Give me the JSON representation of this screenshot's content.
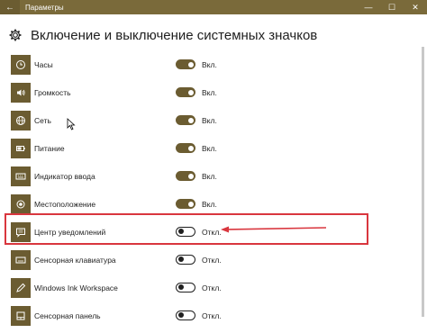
{
  "window": {
    "title": "Параметры",
    "back_glyph": "←",
    "minimize_glyph": "—",
    "maximize_glyph": "☐",
    "close_glyph": "✕"
  },
  "header": {
    "title": "Включение и выключение системных значков",
    "icon": "gear-icon"
  },
  "items": [
    {
      "label": "Часы",
      "state": "Вкл.",
      "on": true,
      "icon": "clock-icon"
    },
    {
      "label": "Громкость",
      "state": "Вкл.",
      "on": true,
      "icon": "volume-icon"
    },
    {
      "label": "Сеть",
      "state": "Вкл.",
      "on": true,
      "icon": "network-icon"
    },
    {
      "label": "Питание",
      "state": "Вкл.",
      "on": true,
      "icon": "power-icon"
    },
    {
      "label": "Индикатор ввода",
      "state": "Вкл.",
      "on": true,
      "icon": "keyboard-icon"
    },
    {
      "label": "Местоположение",
      "state": "Вкл.",
      "on": true,
      "icon": "location-icon"
    },
    {
      "label": "Центр уведомлений",
      "state": "Откл.",
      "on": false,
      "icon": "action-center-icon"
    },
    {
      "label": "Сенсорная клавиатура",
      "state": "Откл.",
      "on": false,
      "icon": "touch-keyboard-icon"
    },
    {
      "label": "Windows Ink Workspace",
      "state": "Откл.",
      "on": false,
      "icon": "pen-icon"
    },
    {
      "label": "Сенсорная панель",
      "state": "Откл.",
      "on": false,
      "icon": "touchpad-icon"
    }
  ],
  "colors": {
    "accent": "#6b5c31",
    "titlebar": "#7a6a3a",
    "highlight": "#d9363e"
  }
}
